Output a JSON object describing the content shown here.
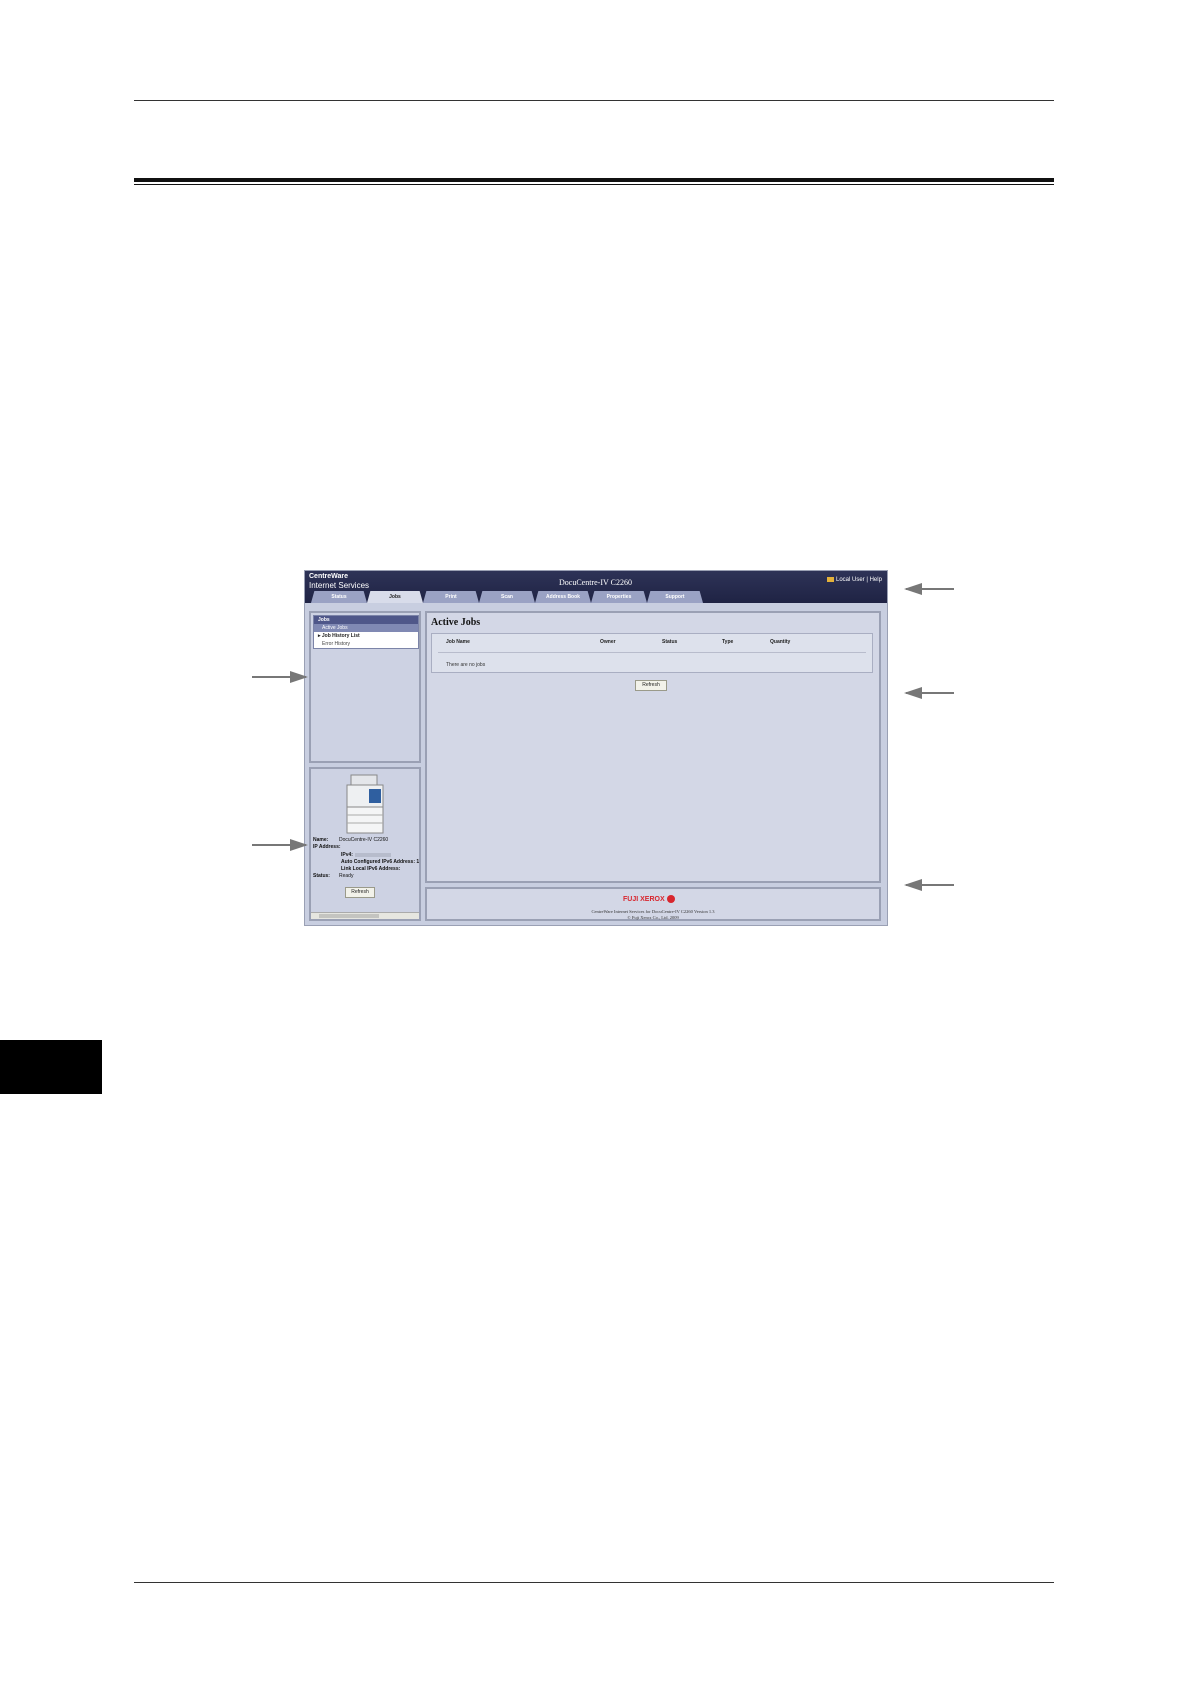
{
  "screenshot": {
    "brand_line1": "CentreWare",
    "brand_line2": "Internet Services",
    "model": "DocuCentre-IV C2260",
    "top_links": "Local User | Help",
    "tabs": [
      "Status",
      "Jobs",
      "Print",
      "Scan",
      "Address Book",
      "Properties",
      "Support"
    ],
    "active_tab": "Jobs",
    "nav": {
      "header": "Jobs",
      "selected": "Active Jobs",
      "item": "Job History List",
      "sub": "Error History"
    },
    "device": {
      "name_label": "Name:",
      "name_value": "DocuCentre-IV C2260",
      "ip_label": "IP Address:",
      "ipv4_label": "IPv4:",
      "auto_ipv6_label": "Auto Configured IPv6 Address: 1",
      "link_ipv6_label": "Link Local IPv6 Address:",
      "status_label": "Status:",
      "status_value": "Ready",
      "refresh_label": "Refresh"
    },
    "main": {
      "title": "Active Jobs",
      "columns": [
        "Job Name",
        "Owner",
        "Status",
        "Type",
        "Quantity"
      ],
      "empty_text": "There are no jobs",
      "refresh_label": "Refresh"
    },
    "footer": {
      "logo": "FUJI XEROX",
      "line1": "CentreWare Internet Services for DocuCentre-IV C2260 Version 1.3",
      "line2": "© Fuji Xerox Co., Ltd. 2009"
    }
  }
}
